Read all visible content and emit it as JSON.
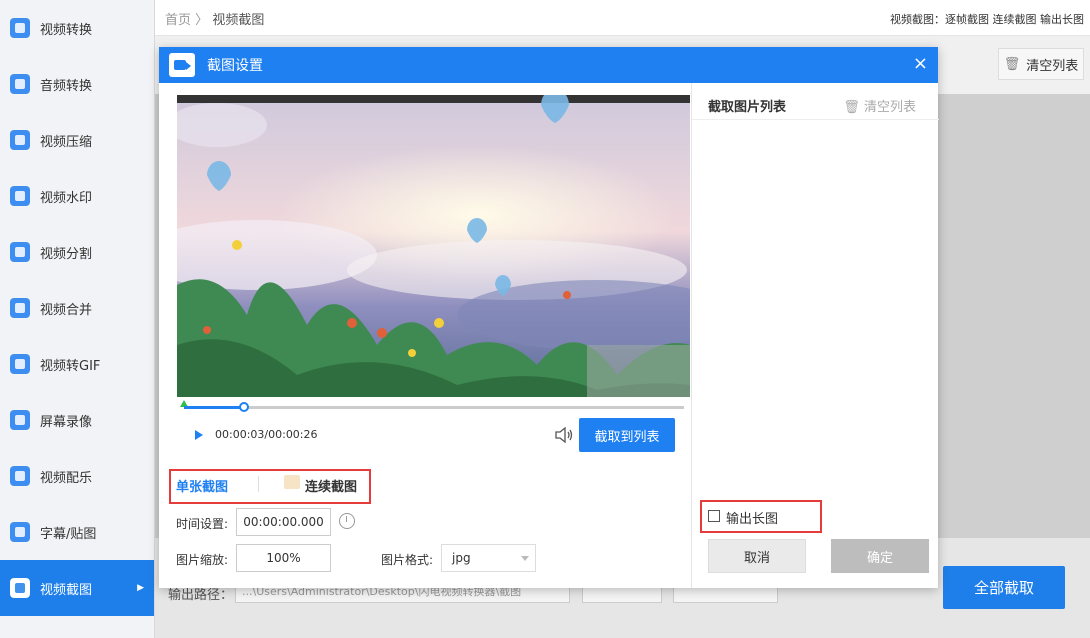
{
  "sidebar": {
    "items": [
      {
        "label": "视频转换",
        "icon": "video-convert-icon"
      },
      {
        "label": "音频转换",
        "icon": "audio-convert-icon"
      },
      {
        "label": "视频压缩",
        "icon": "video-compress-icon"
      },
      {
        "label": "视频水印",
        "icon": "video-watermark-icon"
      },
      {
        "label": "视频分割",
        "icon": "video-split-icon"
      },
      {
        "label": "视频合并",
        "icon": "video-merge-icon"
      },
      {
        "label": "视频转GIF",
        "icon": "video-gif-icon"
      },
      {
        "label": "屏幕录像",
        "icon": "screen-record-icon"
      },
      {
        "label": "视频配乐",
        "icon": "video-music-icon"
      },
      {
        "label": "字幕/贴图",
        "icon": "subtitle-icon"
      },
      {
        "label": "视频截图",
        "icon": "screenshot-icon",
        "active": true
      }
    ]
  },
  "header": {
    "breadcrumb_home": "首页",
    "breadcrumb_sep": "〉",
    "breadcrumb_current": "视频截图",
    "right_text": "视频截图：逐帧截图 连续截图 输出长图"
  },
  "toolbar": {
    "clear_list": "清空列表"
  },
  "output": {
    "label": "输出路径：",
    "path": "...\\Users\\Administrator\\Desktop\\闪电视频转换器\\截图"
  },
  "all_button": "全部截取",
  "modal": {
    "title": "截图设置",
    "close": "×",
    "player": {
      "time": "00:00:03/00:00:26",
      "progress": 0.12,
      "grab_button": "截取到列表"
    },
    "tabs": {
      "single": "单张截图",
      "continuous": "连续截图"
    },
    "time_label": "时间设置:",
    "time_value": "00:00:00.000",
    "scale_label": "图片缩放:",
    "scale_value": "100%",
    "format_label": "图片格式:",
    "format_value": "jpg",
    "list_title": "截取图片列表",
    "list_clear": "清空列表",
    "long_image": "输出长图",
    "cancel": "取消",
    "confirm": "确定"
  },
  "colors": {
    "accent": "#1f80f2",
    "highlight_border": "#e53b3b"
  }
}
